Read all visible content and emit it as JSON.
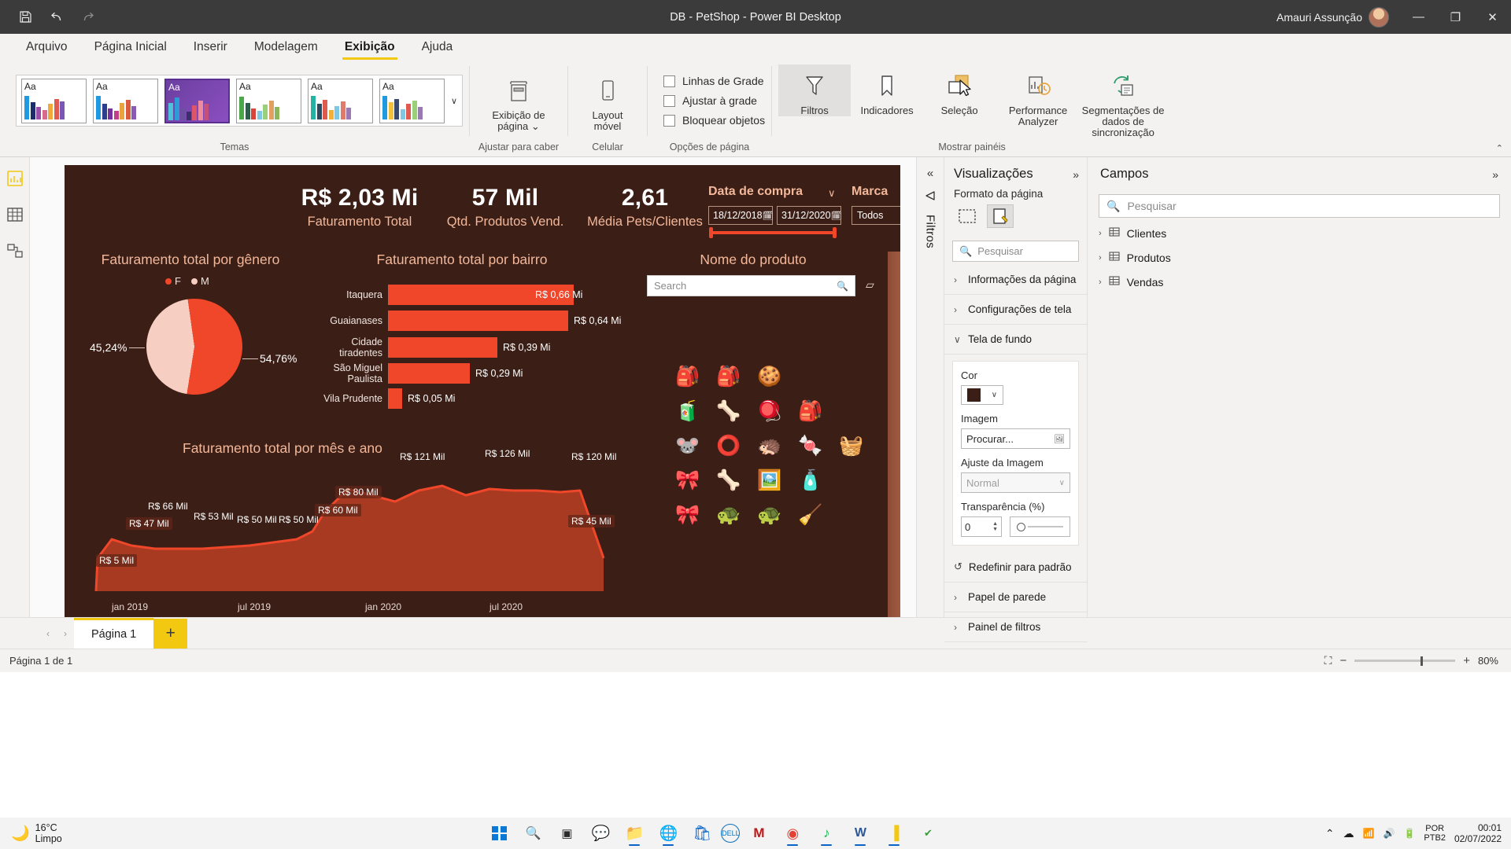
{
  "titlebar": {
    "save_icon": "save-icon",
    "undo_icon": "undo-icon",
    "redo_icon": "redo-icon",
    "title": "DB - PetShop - Power BI Desktop",
    "user": "Amauri Assunção",
    "minimize": "—",
    "maximize": "❐",
    "close": "✕"
  },
  "ribbon_tabs": [
    {
      "label": "Arquivo",
      "active": false
    },
    {
      "label": "Página Inicial",
      "active": false
    },
    {
      "label": "Inserir",
      "active": false
    },
    {
      "label": "Modelagem",
      "active": false
    },
    {
      "label": "Exibição",
      "active": true
    },
    {
      "label": "Ajuda",
      "active": false
    }
  ],
  "ribbon": {
    "themes_group_label": "Temas",
    "themes": [
      {
        "aa": "Aa",
        "selected": false,
        "colors": [
          "#1f9ae0",
          "#1a2e6e",
          "#9a4fa8",
          "#d86a8e",
          "#f2a93b",
          "#e05b4f",
          "#7a56b5"
        ]
      },
      {
        "aa": "Aa",
        "selected": false,
        "colors": [
          "#1f9ae0",
          "#2b3f8f",
          "#7a2fa0",
          "#c2408a",
          "#e8a33d",
          "#d95b3c",
          "#8a5ab5"
        ]
      },
      {
        "aa": "Aa",
        "selected": true,
        "colors": [
          "#4cc3d9",
          "#2f9bd6",
          "#6b4fa0",
          "#3f2e6e",
          "#e0546a",
          "#f08a9e",
          "#c2507a"
        ]
      },
      {
        "aa": "Aa",
        "selected": false,
        "colors": [
          "#4aa84a",
          "#2e5f4a",
          "#d9443b",
          "#7ec8e3",
          "#9ad07a",
          "#e0a060",
          "#8ab85a"
        ]
      },
      {
        "aa": "Aa",
        "selected": false,
        "colors": [
          "#23b3a5",
          "#2b4a5e",
          "#e05b4f",
          "#f2b03b",
          "#7ec8e3",
          "#e07a6a",
          "#9a7ab5"
        ]
      },
      {
        "aa": "Aa",
        "selected": false,
        "colors": [
          "#1f9ae0",
          "#f2c03b",
          "#3a4a6e",
          "#7ec8e3",
          "#e05b4f",
          "#9ad07a",
          "#9a7ab5"
        ]
      }
    ],
    "gallery_more": "∨",
    "page_view": {
      "label_line1": "Exibição de",
      "label_line2": "página",
      "icon": "page-view-icon",
      "group_label": "Ajustar para caber"
    },
    "mobile_layout": {
      "label_line1": "Layout",
      "label_line2": "móvel",
      "icon": "mobile-layout-icon",
      "group_label": "Celular"
    },
    "page_options": {
      "group_label": "Opções de página",
      "checkboxes": [
        {
          "label": "Linhas de Grade",
          "checked": false
        },
        {
          "label": "Ajustar à grade",
          "checked": false
        },
        {
          "label": "Bloquear objetos",
          "checked": false
        }
      ]
    },
    "panes_group_label": "Mostrar painéis",
    "panes": [
      {
        "label": "Filtros",
        "icon": "funnel-icon",
        "active": true
      },
      {
        "label": "Indicadores",
        "icon": "bookmark-icon",
        "active": false
      },
      {
        "label": "Seleção",
        "icon": "selection-icon",
        "active": false
      },
      {
        "label": "Performance Analyzer",
        "icon": "performance-icon",
        "active": false
      },
      {
        "label": "Segmentações de dados de sincronização",
        "icon": "sync-slicers-icon",
        "active": false
      }
    ],
    "collapse_icon": "collapse-ribbon-icon"
  },
  "left_rail": [
    {
      "name": "report-view-icon"
    },
    {
      "name": "data-view-icon"
    },
    {
      "name": "model-view-icon"
    }
  ],
  "report": {
    "background_color": "#3b1f16",
    "accent_color": "#f0462a",
    "kpis": [
      {
        "value": "R$ 2,03 Mi",
        "label": "Faturamento Total"
      },
      {
        "value": "57 Mil",
        "label": "Qtd. Produtos Vend."
      },
      {
        "value": "2,61",
        "label": "Média Pets/Clientes"
      }
    ],
    "date_slicer": {
      "title": "Data de compra",
      "start": "18/12/2018",
      "end": "31/12/2020",
      "calendar_icon": "calendar-icon",
      "caret": "∨"
    },
    "brand_slicer": {
      "title": "Marca",
      "value": "Todos",
      "caret": "∨",
      "dropdown_caret": "∨"
    },
    "pie_chart": {
      "title": "Faturamento total por gênero",
      "legend": [
        {
          "label": "F",
          "color": "#f0462a"
        },
        {
          "label": "M",
          "color": "#f7cfc2"
        }
      ],
      "left_label": "45,24%",
      "right_label": "54,76%"
    },
    "bar_chart": {
      "title": "Faturamento total por bairro",
      "rows": [
        {
          "label": "Itaquera",
          "value_text": "R$ 0,66 Mi",
          "value": 0.66
        },
        {
          "label": "Guaianases",
          "value_text": "R$ 0,64 Mi",
          "value": 0.64
        },
        {
          "label": "Cidade tiradentes",
          "value_text": "R$ 0,39 Mi",
          "value": 0.39
        },
        {
          "label": "São Miguel Paulista",
          "value_text": "R$ 0,29 Mi",
          "value": 0.29
        },
        {
          "label": "Vila Prudente",
          "value_text": "R$ 0,05 Mi",
          "value": 0.05
        }
      ]
    },
    "product_panel": {
      "title": "Nome do produto",
      "search_placeholder": "Search",
      "search_icon": "search-icon",
      "eraser_icon": "eraser-icon",
      "icons": [
        "🎒",
        "🎒",
        "🍪",
        "",
        "",
        "🧃",
        "🦴",
        "🪀",
        "🎒",
        "",
        "🐭",
        "⭕",
        "🦔",
        "🍬",
        "🧺",
        "🎀",
        "🦴",
        "🖼️",
        "🧴",
        "",
        "🎀",
        "🐢",
        "🐢",
        "🧹",
        ""
      ]
    },
    "line_chart": {
      "title": "Faturamento total por mês e ano",
      "x_ticks": [
        "jan 2019",
        "jul 2019",
        "jan 2020",
        "jul 2020"
      ],
      "labels": [
        "R$ 5 Mil",
        "R$ 47 Mil",
        "R$ 66 Mil",
        "R$ 53 Mil",
        "R$ 50 Mil",
        "R$ 50 Mil",
        "R$ 60 Mil",
        "R$ 80 Mil",
        "R$ 121 Mil",
        "R$ 126 Mil",
        "R$ 120 Mil",
        "R$ 45 Mil"
      ]
    }
  },
  "chart_data": [
    {
      "type": "pie",
      "title": "Faturamento total por gênero",
      "categories": [
        "F",
        "M"
      ],
      "values": [
        54.76,
        45.24
      ],
      "labels": [
        "54,76%",
        "45,24%"
      ],
      "colors": [
        "#f0462a",
        "#f7cfc2"
      ],
      "legend_position": "top"
    },
    {
      "type": "bar",
      "title": "Faturamento total por bairro",
      "categories": [
        "Itaquera",
        "Guaianases",
        "Cidade tiradentes",
        "São Miguel Paulista",
        "Vila Prudente"
      ],
      "values": [
        0.66,
        0.64,
        0.39,
        0.29,
        0.05
      ],
      "value_labels": [
        "R$ 0,66 Mi",
        "R$ 0,64 Mi",
        "R$ 0,39 Mi",
        "R$ 0,29 Mi",
        "R$ 0,05 Mi"
      ],
      "xlabel": "",
      "ylabel": "",
      "xlim": [
        0,
        0.72
      ],
      "orientation": "horizontal",
      "grid": false
    },
    {
      "type": "area",
      "title": "Faturamento total por mês e ano",
      "x": [
        "jan 2019",
        "fev 2019",
        "mar 2019",
        "abr 2019",
        "mai 2019",
        "jun 2019",
        "jul 2019",
        "ago 2019",
        "set 2019",
        "out 2019",
        "nov 2019",
        "dez 2019",
        "jan 2020",
        "fev 2020",
        "mar 2020",
        "abr 2020",
        "mai 2020",
        "jun 2020",
        "jul 2020",
        "ago 2020",
        "set 2020",
        "out 2020",
        "nov 2020",
        "dez 2020"
      ],
      "values": [
        5,
        47,
        66,
        53,
        50,
        50,
        50,
        50,
        50,
        52,
        55,
        60,
        80,
        121,
        118,
        112,
        120,
        126,
        118,
        122,
        120,
        120,
        118,
        45
      ],
      "value_labels": [
        "R$ 5 Mil",
        "R$ 47 Mil",
        "R$ 66 Mil",
        "R$ 53 Mil",
        "R$ 50 Mil",
        "R$ 50 Mil",
        "R$ 60 Mil",
        "R$ 80 Mil",
        "R$ 121 Mil",
        "R$ 126 Mil",
        "R$ 120 Mil",
        "R$ 45 Mil"
      ],
      "xlabel": "",
      "ylabel": "",
      "x_ticks": [
        "jan 2019",
        "jul 2019",
        "jan 2020",
        "jul 2020"
      ],
      "ylim": [
        0,
        140
      ],
      "grid": false,
      "line_color": "#f0462a",
      "fill_color": "#a83a22"
    }
  ],
  "page_tabs": {
    "prev_icon": "‹",
    "next_icon": "›",
    "tabs": [
      {
        "label": "Página 1",
        "active": true
      }
    ],
    "add_label": "+"
  },
  "status_bar": {
    "left_text": "Página 1 de 1",
    "fit_icon": "fit-to-page-icon",
    "zoom_out": "−",
    "zoom_in": "+",
    "zoom_level": "80%"
  },
  "filters_strip": {
    "collapse_icon": "«",
    "filter_icon": "filter-arrow-icon",
    "label": "Filtros"
  },
  "visualizations_pane": {
    "title": "Visualizações",
    "expand_icon": "»",
    "format_label": "Formato da página",
    "format_icons": [
      {
        "name": "page-size-icon",
        "selected": false
      },
      {
        "name": "page-format-icon",
        "selected": true
      }
    ],
    "search_placeholder": "Pesquisar",
    "search_icon": "search-icon",
    "sections": [
      {
        "label": "Informações da página",
        "expanded": false,
        "chev": "›"
      },
      {
        "label": "Configurações de tela",
        "expanded": false,
        "chev": "›"
      },
      {
        "label": "Tela de fundo",
        "expanded": true,
        "chev": "∨"
      }
    ],
    "background_card": {
      "color_label": "Cor",
      "color_value": "#3b1f16",
      "color_caret": "∨",
      "image_label": "Imagem",
      "image_button": "Procurar...",
      "image_icon": "image-browse-icon",
      "fit_label": "Ajuste da Imagem",
      "fit_value": "Normal",
      "fit_caret": "∨",
      "transparency_label": "Transparência (%)",
      "transparency_value": "0"
    },
    "reset_label": "Redefinir para padrão",
    "reset_icon": "reset-icon",
    "sections_after": [
      {
        "label": "Papel de parede",
        "chev": "›"
      },
      {
        "label": "Painel de filtros",
        "chev": "›"
      }
    ]
  },
  "fields_pane": {
    "title": "Campos",
    "expand_icon": "»",
    "search_placeholder": "Pesquisar",
    "search_icon": "search-icon",
    "tables": [
      {
        "label": "Clientes",
        "chev": "›",
        "icon": "table-icon"
      },
      {
        "label": "Produtos",
        "chev": "›",
        "icon": "table-icon"
      },
      {
        "label": "Vendas",
        "chev": "›",
        "icon": "table-icon"
      }
    ]
  },
  "taskbar": {
    "weather": {
      "temp": "16°C",
      "condition": "Limpo",
      "icon": "moon-icon"
    },
    "apps": [
      {
        "name": "start-windows-icon",
        "glyph": "",
        "running": false
      },
      {
        "name": "search-icon",
        "glyph": "🔍",
        "running": false
      },
      {
        "name": "task-view-icon",
        "glyph": "▣",
        "running": false
      },
      {
        "name": "teams-chat-icon",
        "glyph": "💬",
        "running": false
      },
      {
        "name": "file-explorer-icon",
        "glyph": "📁",
        "running": true
      },
      {
        "name": "edge-icon",
        "glyph": "🌐",
        "running": true
      },
      {
        "name": "store-icon",
        "glyph": "🛍",
        "running": false
      },
      {
        "name": "dell-icon",
        "glyph": "DELL",
        "running": false
      },
      {
        "name": "mcafee-icon",
        "glyph": "M",
        "running": false
      },
      {
        "name": "chrome-icon",
        "glyph": "◉",
        "running": true
      },
      {
        "name": "spotify-icon",
        "glyph": "♪",
        "running": true
      },
      {
        "name": "word-icon",
        "glyph": "W",
        "running": true
      },
      {
        "name": "power-bi-icon",
        "glyph": "▐",
        "running": true
      },
      {
        "name": "security-icon",
        "glyph": "✔",
        "running": false
      }
    ],
    "tray": {
      "overflow_icon": "⌃",
      "cloud_icon": "☁",
      "wifi_icon": "📶",
      "volume_icon": "🔊",
      "battery_icon": "🔋",
      "lang_line1": "POR",
      "lang_line2": "PTB2",
      "clock_time": "00:01",
      "clock_date": "02/07/2022"
    }
  }
}
